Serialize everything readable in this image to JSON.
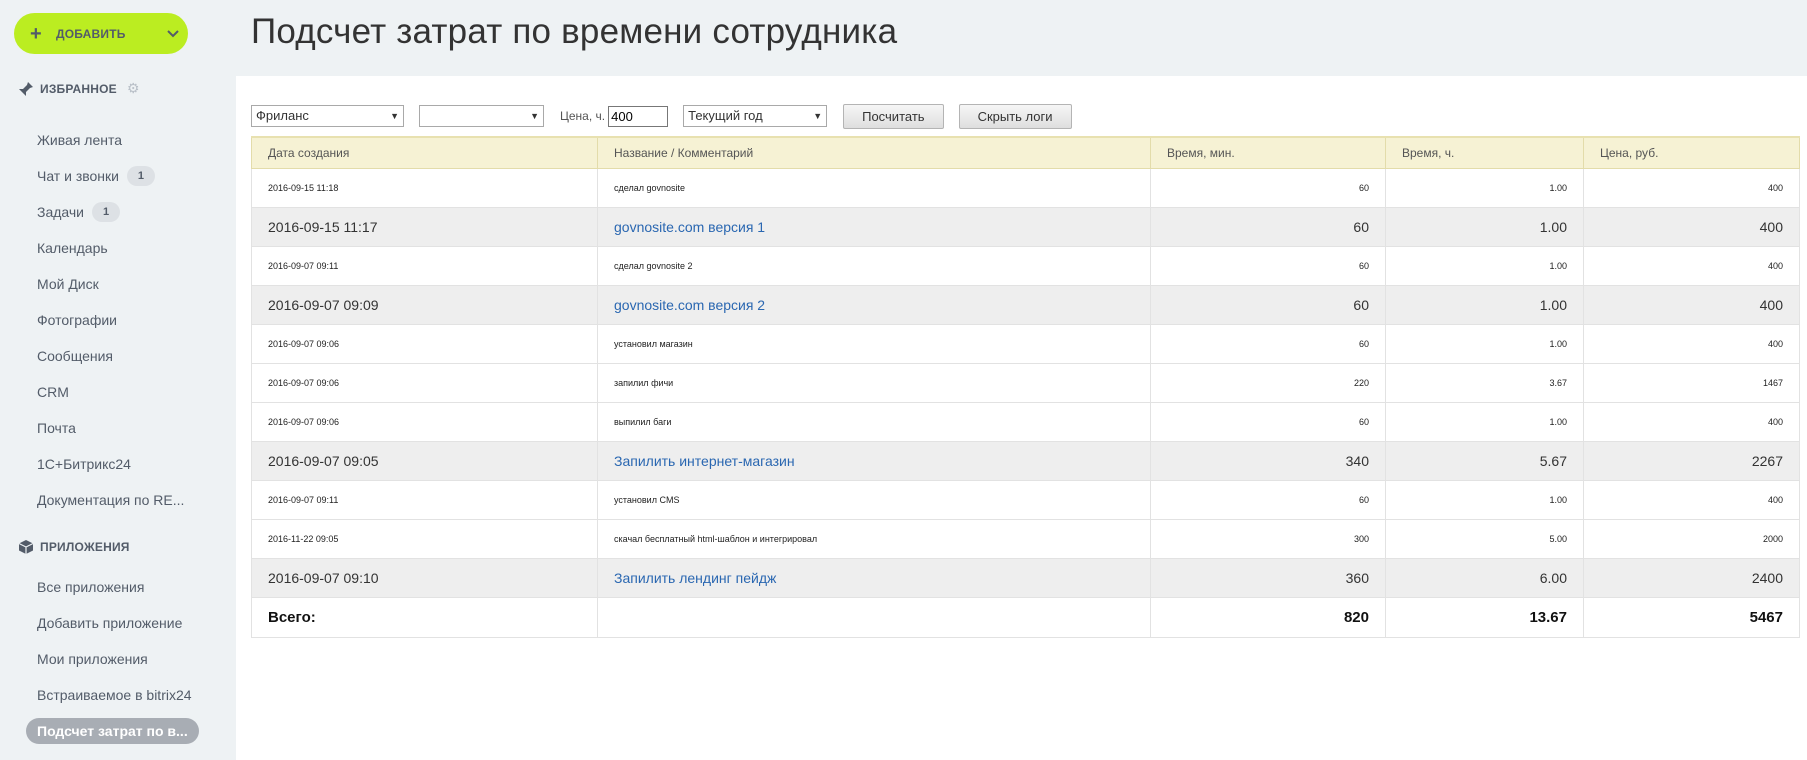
{
  "sidebar": {
    "add_button": "ДОБАВИТЬ",
    "favorites_title": "ИЗБРАННОЕ",
    "favorites": [
      {
        "label": "Живая лента",
        "count": ""
      },
      {
        "label": "Чат и звонки",
        "count": "1"
      },
      {
        "label": "Задачи",
        "count": "1"
      },
      {
        "label": "Календарь",
        "count": ""
      },
      {
        "label": "Мой Диск",
        "count": ""
      },
      {
        "label": "Фотографии",
        "count": ""
      },
      {
        "label": "Сообщения",
        "count": ""
      },
      {
        "label": "CRM",
        "count": ""
      },
      {
        "label": "Почта",
        "count": ""
      },
      {
        "label": "1С+Битрикс24",
        "count": ""
      },
      {
        "label": "Документация по RE...",
        "count": ""
      }
    ],
    "apps_title": "ПРИЛОЖЕНИЯ",
    "apps": [
      {
        "label": "Все приложения"
      },
      {
        "label": "Добавить приложение"
      },
      {
        "label": "Мои приложения"
      },
      {
        "label": "Встраиваемое в bitrix24"
      },
      {
        "label": "Подсчет затрат по в..."
      }
    ]
  },
  "page": {
    "title": "Подсчет затрат по времени сотрудника"
  },
  "filters": {
    "employee_select": "Фриланс",
    "project_select": "",
    "price_label": "Цена, ч.",
    "price_value": "400",
    "period_select": "Текущий год",
    "calc_button": "Посчитать",
    "hide_logs_button": "Скрыть логи"
  },
  "table": {
    "headers": [
      "Дата создания",
      "Название / Комментарий",
      "Время, мин.",
      "Время, ч.",
      "Цена, руб."
    ],
    "rows": [
      {
        "type": "log",
        "date": "2016-09-15 11:18",
        "name": "сделал govnosite",
        "min": "60",
        "hours": "1.00",
        "price": "400"
      },
      {
        "type": "task",
        "date": "2016-09-15 11:17",
        "name": "govnosite.com версия 1",
        "min": "60",
        "hours": "1.00",
        "price": "400"
      },
      {
        "type": "log",
        "date": "2016-09-07 09:11",
        "name": "сделал govnosite 2",
        "min": "60",
        "hours": "1.00",
        "price": "400"
      },
      {
        "type": "task",
        "date": "2016-09-07 09:09",
        "name": "govnosite.com версия 2",
        "min": "60",
        "hours": "1.00",
        "price": "400"
      },
      {
        "type": "log",
        "date": "2016-09-07 09:06",
        "name": "установил магазин",
        "min": "60",
        "hours": "1.00",
        "price": "400"
      },
      {
        "type": "log",
        "date": "2016-09-07 09:06",
        "name": "запилил фичи",
        "min": "220",
        "hours": "3.67",
        "price": "1467"
      },
      {
        "type": "log",
        "date": "2016-09-07 09:06",
        "name": "выпилил баги",
        "min": "60",
        "hours": "1.00",
        "price": "400"
      },
      {
        "type": "task",
        "date": "2016-09-07 09:05",
        "name": "Запилить интернет-магазин",
        "min": "340",
        "hours": "5.67",
        "price": "2267"
      },
      {
        "type": "log",
        "date": "2016-09-07 09:11",
        "name": "установил CMS",
        "min": "60",
        "hours": "1.00",
        "price": "400"
      },
      {
        "type": "log",
        "date": "2016-11-22 09:05",
        "name": "скачал бесплатный html-шаблон и интегрировал",
        "min": "300",
        "hours": "5.00",
        "price": "2000"
      },
      {
        "type": "task",
        "date": "2016-09-07 09:10",
        "name": "Запилить лендинг пейдж",
        "min": "360",
        "hours": "6.00",
        "price": "2400"
      }
    ],
    "total": {
      "label": "Всего:",
      "min": "820",
      "hours": "13.67",
      "price": "5467"
    }
  }
}
